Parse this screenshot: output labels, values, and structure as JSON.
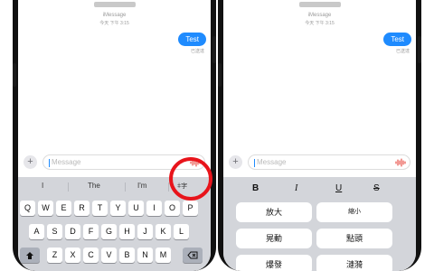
{
  "left_phone": {
    "contact_name": "████",
    "service_label": "iMessage",
    "timestamp": "今天 下午 3:15",
    "message": "Test",
    "read_receipt": "已送達",
    "composer_placeholder": "Message",
    "suggestions": [
      "I",
      "The",
      "I'm"
    ],
    "text_effects_button": "字",
    "keyboard": {
      "row1": [
        "Q",
        "W",
        "E",
        "R",
        "T",
        "Y",
        "U",
        "I",
        "O",
        "P"
      ],
      "row2": [
        "A",
        "S",
        "D",
        "F",
        "G",
        "H",
        "J",
        "K",
        "L"
      ],
      "row3": [
        "Z",
        "X",
        "C",
        "V",
        "B",
        "N",
        "M"
      ]
    }
  },
  "right_phone": {
    "contact_name": "████",
    "service_label": "iMessage",
    "timestamp": "今天 下午 3:15",
    "message": "Test",
    "read_receipt": "已送達",
    "composer_placeholder": "Message",
    "format_buttons": [
      "B",
      "I",
      "U",
      "S"
    ],
    "effects": [
      "放大",
      "縮小",
      "晃動",
      "點頭",
      "爆發",
      "漣漪"
    ]
  },
  "colors": {
    "bubble": "#1f8bfe",
    "highlight": "#e8141b",
    "keyboard_bg": "#d3d5da"
  }
}
